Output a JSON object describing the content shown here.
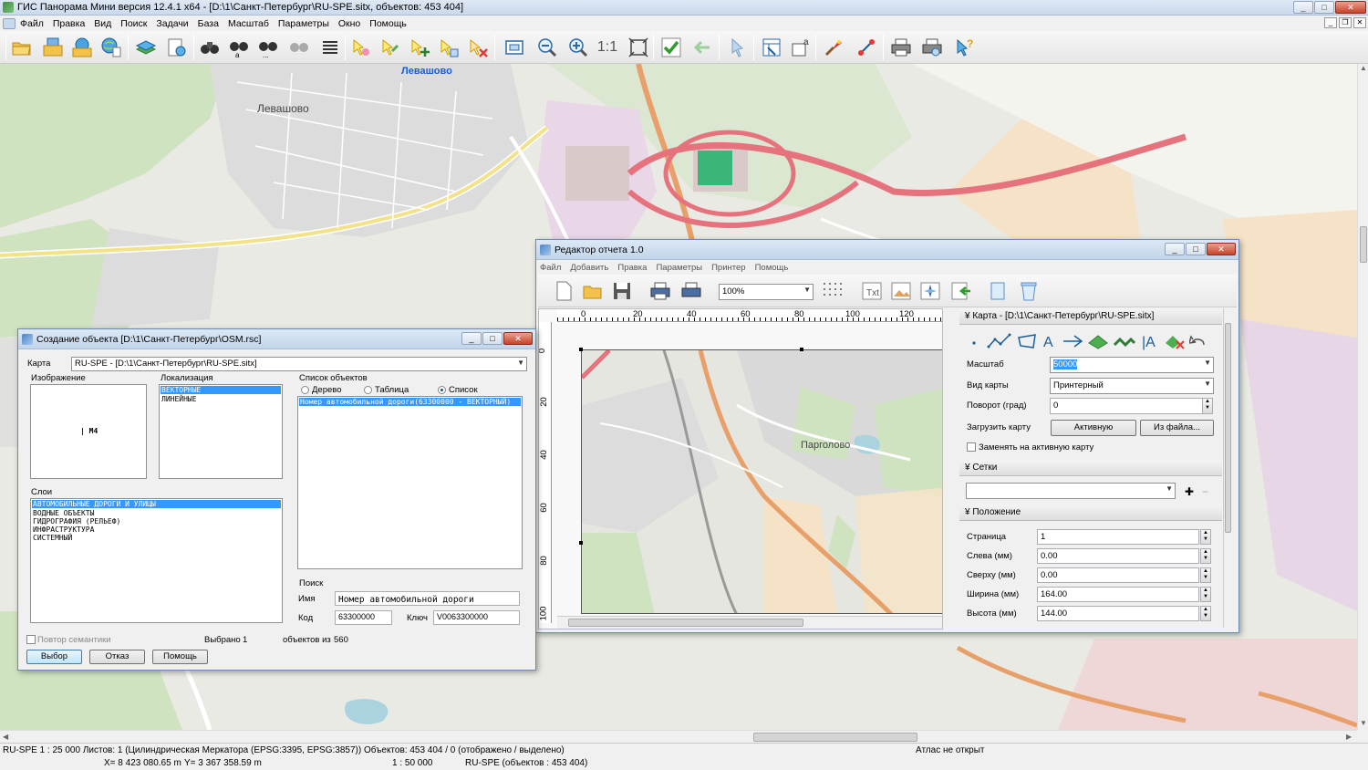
{
  "window": {
    "title": "ГИС Панорама Мини версия 12.4.1 x64 - [D:\\1\\Санкт-Петербург\\RU-SPE.sitx, объектов: 453 404]"
  },
  "menu": [
    "Файл",
    "Правка",
    "Вид",
    "Поиск",
    "Задачи",
    "База",
    "Масштаб",
    "Параметры",
    "Окно",
    "Помощь"
  ],
  "toolbar": {
    "scale_1_1": "1:1"
  },
  "map": {
    "labels": {
      "levashovo_top": "Левашово",
      "levashovo": "Левашово",
      "pargolovo": "Парголово"
    },
    "colors": {
      "background": "#eaeae4",
      "forest": "#cfe3c1",
      "residential": "#dcdcdc",
      "industrial": "#e9d6e6",
      "main_road": "#e8a06a",
      "highway": "#e6727d",
      "water": "#aad3df"
    }
  },
  "status": {
    "map_info": "RU-SPE  1 : 25 000  Листов: 1   (Цилиндрическая Меркатора (EPSG:3395, EPSG:3857))  Объектов: 453 404 / 0 (отображено / выделено)",
    "atlas": "Атлас не открыт",
    "x": "X= 8 423 080.65 m",
    "y": "Y= 3 367 358.59 m",
    "scale": "1 : 50 000",
    "objects": "RU-SPE  (объектов : 453 404)"
  },
  "create_dialog": {
    "title": "Создание объекта [D:\\1\\Санкт-Петербург\\OSM.rsc]",
    "map_label": "Карта",
    "map_value": "RU-SPE - [D:\\1\\Санкт-Петербург\\RU-SPE.sitx]",
    "image_label": "Изображение",
    "image_glyph": "| M4",
    "localization_label": "Локализация",
    "localization": [
      "ВЕКТОРНЫЕ",
      "ЛИНЕЙНЫЕ"
    ],
    "objects_label": "Список объектов",
    "view_tree": "Дерево",
    "view_table": "Таблица",
    "view_list": "Список",
    "objects": [
      "Номер автомобильной дороги(63300000 - ВЕКТОРНЫЙ)"
    ],
    "layers_label": "Слои",
    "layers": [
      "АВТОМОБИЛЬНЫЕ ДОРОГИ И УЛИЦЫ",
      "ВОДНЫЕ ОБЪЕКТЫ",
      "ГИДРОГРАФИЯ (РЕЛЬЕФ)",
      "ИНФРАСТРУКТУРА",
      "СИСТЕМНЫЙ"
    ],
    "search_label": "Поиск",
    "name_label": "Имя",
    "name_value": "Номер автомобильной дороги",
    "code_label": "Код",
    "code_value": "63300000",
    "key_label": "Ключ",
    "key_value": "V0063300000",
    "repeat_semantics": "Повтор семантики",
    "selected_label": "Выбрано",
    "selected_value": "1",
    "of_label": "объектов из",
    "total_value": "560",
    "btn_select": "Выбор",
    "btn_cancel": "Отказ",
    "btn_help": "Помощь"
  },
  "report_editor": {
    "title": "Редактор отчета 1.0",
    "menu": [
      "Файл",
      "Добавить",
      "Правка",
      "Параметры",
      "Принтер",
      "Помощь"
    ],
    "zoom": "100%",
    "ruler_h": [
      "0",
      "20",
      "40",
      "60",
      "80",
      "100",
      "120"
    ],
    "ruler_v": [
      "0",
      "20",
      "40",
      "60",
      "80",
      "100"
    ],
    "preview_label": "Парголово",
    "panel": {
      "map_section": "Карта - [D:\\1\\Санкт-Петербург\\RU-SPE.sitx]",
      "scale_label": "Масштаб",
      "scale_value": "50000",
      "map_type_label": "Вид карты",
      "map_type_value": "Принтерный",
      "rotation_label": "Поворот (град)",
      "rotation_value": "0",
      "load_map_label": "Загрузить карту",
      "btn_active": "Активную",
      "btn_from_file": "Из файла...",
      "replace_active": "Заменять на активную карту",
      "grids_section": "Сетки",
      "position_section": "Положение",
      "page_label": "Страница",
      "page_value": "1",
      "left_label": "Слева (мм)",
      "left_value": "0.00",
      "top_label": "Сверху (мм)",
      "top_value": "0.00",
      "width_label": "Ширина (мм)",
      "width_value": "164.00",
      "height_label": "Высота (мм)",
      "height_value": "144.00"
    }
  }
}
